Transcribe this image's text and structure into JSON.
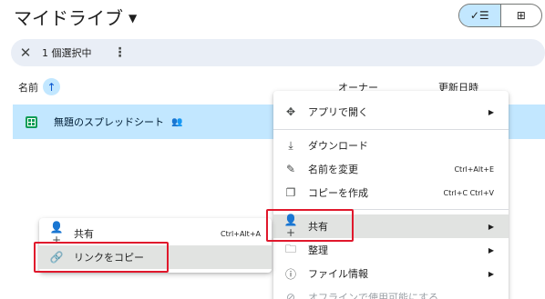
{
  "header": {
    "title": "マイドライブ",
    "view_list_icon": "check-list-icon",
    "view_grid_icon": "grid-icon"
  },
  "selection_bar": {
    "count_text": "1 個選択中"
  },
  "columns": {
    "name": "名前",
    "owner": "オーナー",
    "modified": "更新日時"
  },
  "file": {
    "name": "無題のスプレッドシート"
  },
  "menu_right": {
    "open_with": "アプリで開く",
    "download": "ダウンロード",
    "rename": "名前を変更",
    "rename_shortcut": "Ctrl+Alt+E",
    "copy": "コピーを作成",
    "copy_shortcut": "Ctrl+C Ctrl+V",
    "share": "共有",
    "organize": "整理",
    "file_info": "ファイル情報",
    "offline": "オフラインで使用可能にする"
  },
  "menu_left": {
    "share": "共有",
    "share_shortcut": "Ctrl+Alt+A",
    "copy_link": "リンクをコピー"
  },
  "colors": {
    "accent": "#c2e7ff",
    "selection_bar": "#e9eef6",
    "highlight_box": "#e0182c",
    "sheets_green": "#0f9d58"
  }
}
